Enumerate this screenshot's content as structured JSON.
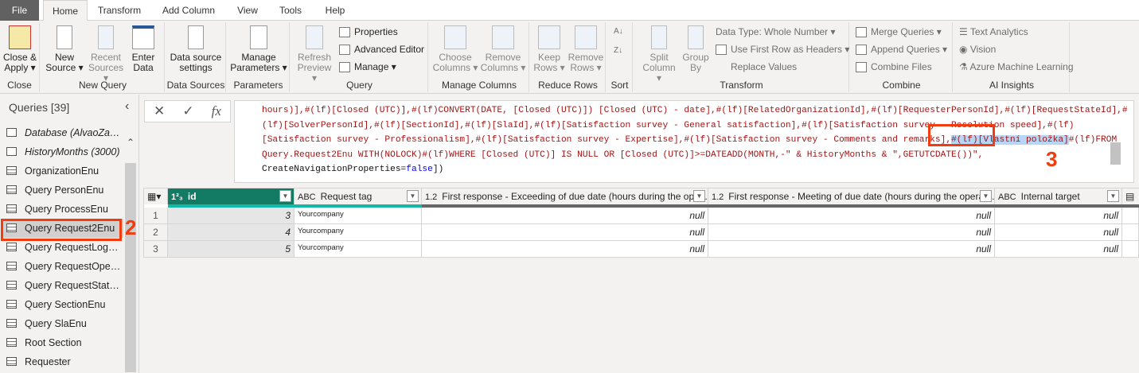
{
  "tabs": [
    "File",
    "Home",
    "Transform",
    "Add Column",
    "View",
    "Tools",
    "Help"
  ],
  "ribbon": {
    "close": {
      "label1": "Close &",
      "label2": "Apply ▾",
      "group": "Close"
    },
    "new_query": {
      "new1": "New",
      "new2": "Source ▾",
      "recent1": "Recent",
      "recent2": "Sources ▾",
      "enter1": "Enter",
      "enter2": "Data",
      "group": "New Query"
    },
    "data_sources": {
      "l1": "Data source",
      "l2": "settings",
      "group": "Data Sources"
    },
    "parameters": {
      "l1": "Manage",
      "l2": "Parameters ▾",
      "group": "Parameters"
    },
    "query": {
      "refresh1": "Refresh",
      "refresh2": "Preview ▾",
      "properties": "Properties",
      "advanced": "Advanced Editor",
      "manage": "Manage ▾",
      "group": "Query"
    },
    "manage_columns": {
      "choose1": "Choose",
      "choose2": "Columns ▾",
      "remove1": "Remove",
      "remove2": "Columns ▾",
      "group": "Manage Columns"
    },
    "reduce_rows": {
      "keep1": "Keep",
      "keep2": "Rows ▾",
      "remove1": "Remove",
      "remove2": "Rows ▾",
      "group": "Reduce Rows"
    },
    "sort": {
      "group": "Sort"
    },
    "transform": {
      "split1": "Split",
      "split2": "Column ▾",
      "group1": "Group",
      "group2": "By",
      "data_type": "Data Type: Whole Number ▾",
      "first_row": "Use First Row as Headers ▾",
      "replace": "Replace Values",
      "group": "Transform"
    },
    "combine": {
      "merge": "Merge Queries ▾",
      "append": "Append Queries ▾",
      "files": "Combine Files",
      "group": "Combine"
    },
    "ai": {
      "text": "Text Analytics",
      "vision": "Vision",
      "azure": "Azure Machine Learning",
      "group": "AI Insights"
    }
  },
  "sidebar": {
    "title": "Queries [39]",
    "items": [
      {
        "label": "Database (AlvaoZaka...",
        "type": "param"
      },
      {
        "label": "HistoryMonths (3000)",
        "type": "param"
      },
      {
        "label": "OrganizationEnu",
        "type": "table"
      },
      {
        "label": "Query PersonEnu",
        "type": "table"
      },
      {
        "label": "Query ProcessEnu",
        "type": "table"
      },
      {
        "label": "Query Request2Enu",
        "type": "table",
        "selected": true
      },
      {
        "label": "Query RequestLogRe...",
        "type": "table"
      },
      {
        "label": "Query RequestOperat...",
        "type": "table"
      },
      {
        "label": "Query RequestStateE...",
        "type": "table"
      },
      {
        "label": "Query SectionEnu",
        "type": "table"
      },
      {
        "label": "Query SlaEnu",
        "type": "table"
      },
      {
        "label": "Root Section",
        "type": "table"
      },
      {
        "label": "Requester",
        "type": "table"
      }
    ]
  },
  "formula": {
    "cancel": "✕",
    "commit": "✓",
    "fx": "fx",
    "line1": "hours)],#(lf)[Closed (UTC)],#(lf)CONVERT(DATE, [Closed (UTC)]) [Closed (UTC) - date],#(lf)[RelatedOrganizationId],#(lf)[RequesterPersonId],#(lf)[RequestStateId],#",
    "line2": "(lf)[SolverPersonId],#(lf)[SectionId],#(lf)[SlaId],#(lf)[Satisfaction survey - General satisfaction],#(lf)[Satisfaction survey - Resolution speed],#(lf)",
    "line3a": "[Satisfaction survey - Professionalism],#(lf)[Satisfaction survey - Expertise],#(lf)[Satisfaction survey - Comments and remarks],",
    "line3hl": "#(lf)[Vlastní položka]",
    "line3b": "#(lf)FROM",
    "line4": "Query.Request2Enu WITH(NOLOCK)#(lf)WHERE [Closed (UTC)] IS NULL OR [Closed (UTC)]>=DATEADD(MONTH,-\" & HistoryMonths & \",GETUTCDATE())\",",
    "line5a": "CreateNavigationProperties=",
    "line5b": "false",
    "line5c": "])"
  },
  "annotations": {
    "two": "2",
    "three": "3"
  },
  "table": {
    "columns": [
      {
        "type": "1²₃",
        "name": "id"
      },
      {
        "type": "ABC",
        "name": "Request tag"
      },
      {
        "type": "1.2",
        "name": "First response - Exceeding of due date (hours during the oper..."
      },
      {
        "type": "1.2",
        "name": "First response - Meeting of due date (hours during the operat..."
      },
      {
        "type": "ABC",
        "name": "Internal target"
      }
    ],
    "rows": [
      {
        "n": "1",
        "id": "3",
        "tag": "Yourcompany",
        "c3": "null",
        "c4": "null",
        "c5": "null"
      },
      {
        "n": "2",
        "id": "4",
        "tag": "Yourcompany",
        "c3": "null",
        "c4": "null",
        "c5": "null"
      },
      {
        "n": "3",
        "id": "5",
        "tag": "Yourcompany",
        "c3": "null",
        "c4": "null",
        "c5": "null"
      }
    ]
  }
}
